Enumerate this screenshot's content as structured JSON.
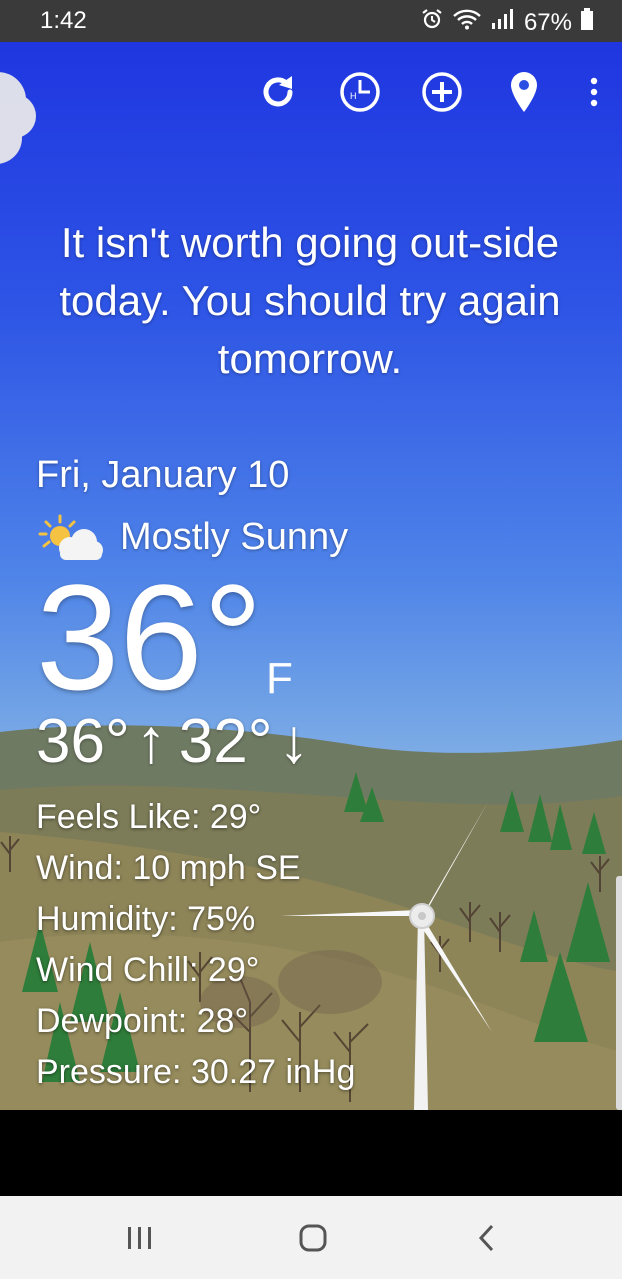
{
  "status_bar": {
    "time": "1:42",
    "battery": "67%",
    "icons": [
      "alarm-icon",
      "wifi-icon",
      "signal-icon",
      "battery-icon"
    ]
  },
  "toolbar": {
    "buttons": [
      "refresh-icon",
      "hourly-clock-icon",
      "add-location-icon",
      "location-pin-icon",
      "more-vert-icon"
    ]
  },
  "forecast": {
    "headline": "It isn't worth going out-side today. You should try again tomorrow.",
    "date": "Fri, January 10",
    "condition": "Mostly Sunny",
    "condition_icon": "partly-sunny-icon",
    "temperature": "36°",
    "unit": "F",
    "high": "36°",
    "low": "32°",
    "details": [
      "Feels Like: 29°",
      "Wind: 10 mph SE",
      "Humidity: 75%",
      "Wind Chill: 29°",
      "Dewpoint: 28°",
      "Pressure: 30.27 inHg"
    ]
  },
  "colors": {
    "sky_top": "#1f36e0",
    "sky_bottom": "#87b3e4",
    "hill_far": "#6f7a63",
    "hill_near": "#8d8458",
    "tree_green": "#2f7d3a"
  },
  "nav": [
    "recent-apps-icon",
    "home-icon",
    "back-icon"
  ]
}
